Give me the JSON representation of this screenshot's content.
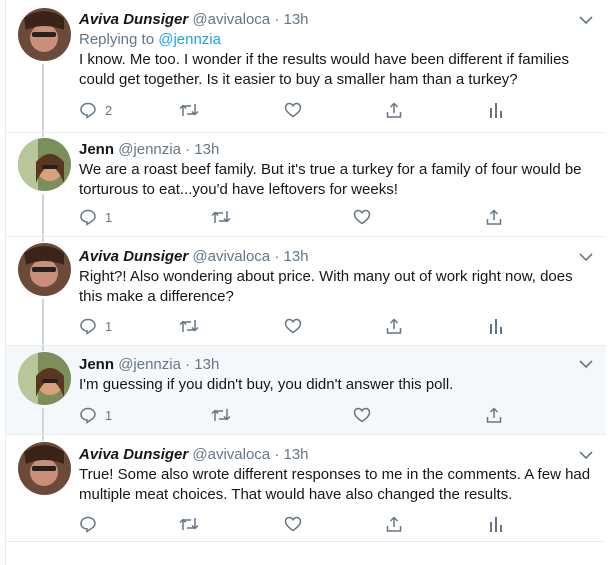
{
  "tweets": [
    {
      "name": "Aviva Dunsiger",
      "handle": "@avivaloca",
      "time": "13h",
      "replying_prefix": "Replying to",
      "replying_to": "@jennzia",
      "text": "I know. Me too. I wonder if the results would have been different if families could get together. Is it easier to buy a smaller ham than a turkey?",
      "reply_count": "2",
      "avatar_colors": [
        "#6b4a3a",
        "#c98f7a"
      ]
    },
    {
      "name": "Jenn",
      "handle": "@jennzia",
      "time": "13h",
      "text": "We are a roast beef family. But it's true a turkey for a family of four would be torturous to eat...you'd have leftovers for weeks!",
      "reply_count": "1",
      "avatar_colors": [
        "#7a8f5a",
        "#d9a07c"
      ]
    },
    {
      "name": "Aviva Dunsiger",
      "handle": "@avivaloca",
      "time": "13h",
      "text": "Right?! Also wondering about price. With many out of work right now, does this make a difference?",
      "reply_count": "1",
      "avatar_colors": [
        "#6b4a3a",
        "#c98f7a"
      ]
    },
    {
      "name": "Jenn",
      "handle": "@jennzia",
      "time": "13h",
      "text": "I'm guessing if you didn't buy, you didn't answer this poll.",
      "reply_count": "1",
      "avatar_colors": [
        "#7a8f5a",
        "#d9a07c"
      ]
    },
    {
      "name": "Aviva Dunsiger",
      "handle": "@avivaloca",
      "time": "13h",
      "text": "True! Some also wrote different responses to me in the comments. A few had multiple meat choices. That would have also changed the results.",
      "reply_count": "",
      "avatar_colors": [
        "#6b4a3a",
        "#c98f7a"
      ]
    }
  ],
  "separator": "·",
  "colors": {
    "accent": "#1da1f2",
    "muted": "#657786",
    "highlight_bg": "#f5f8fa"
  }
}
